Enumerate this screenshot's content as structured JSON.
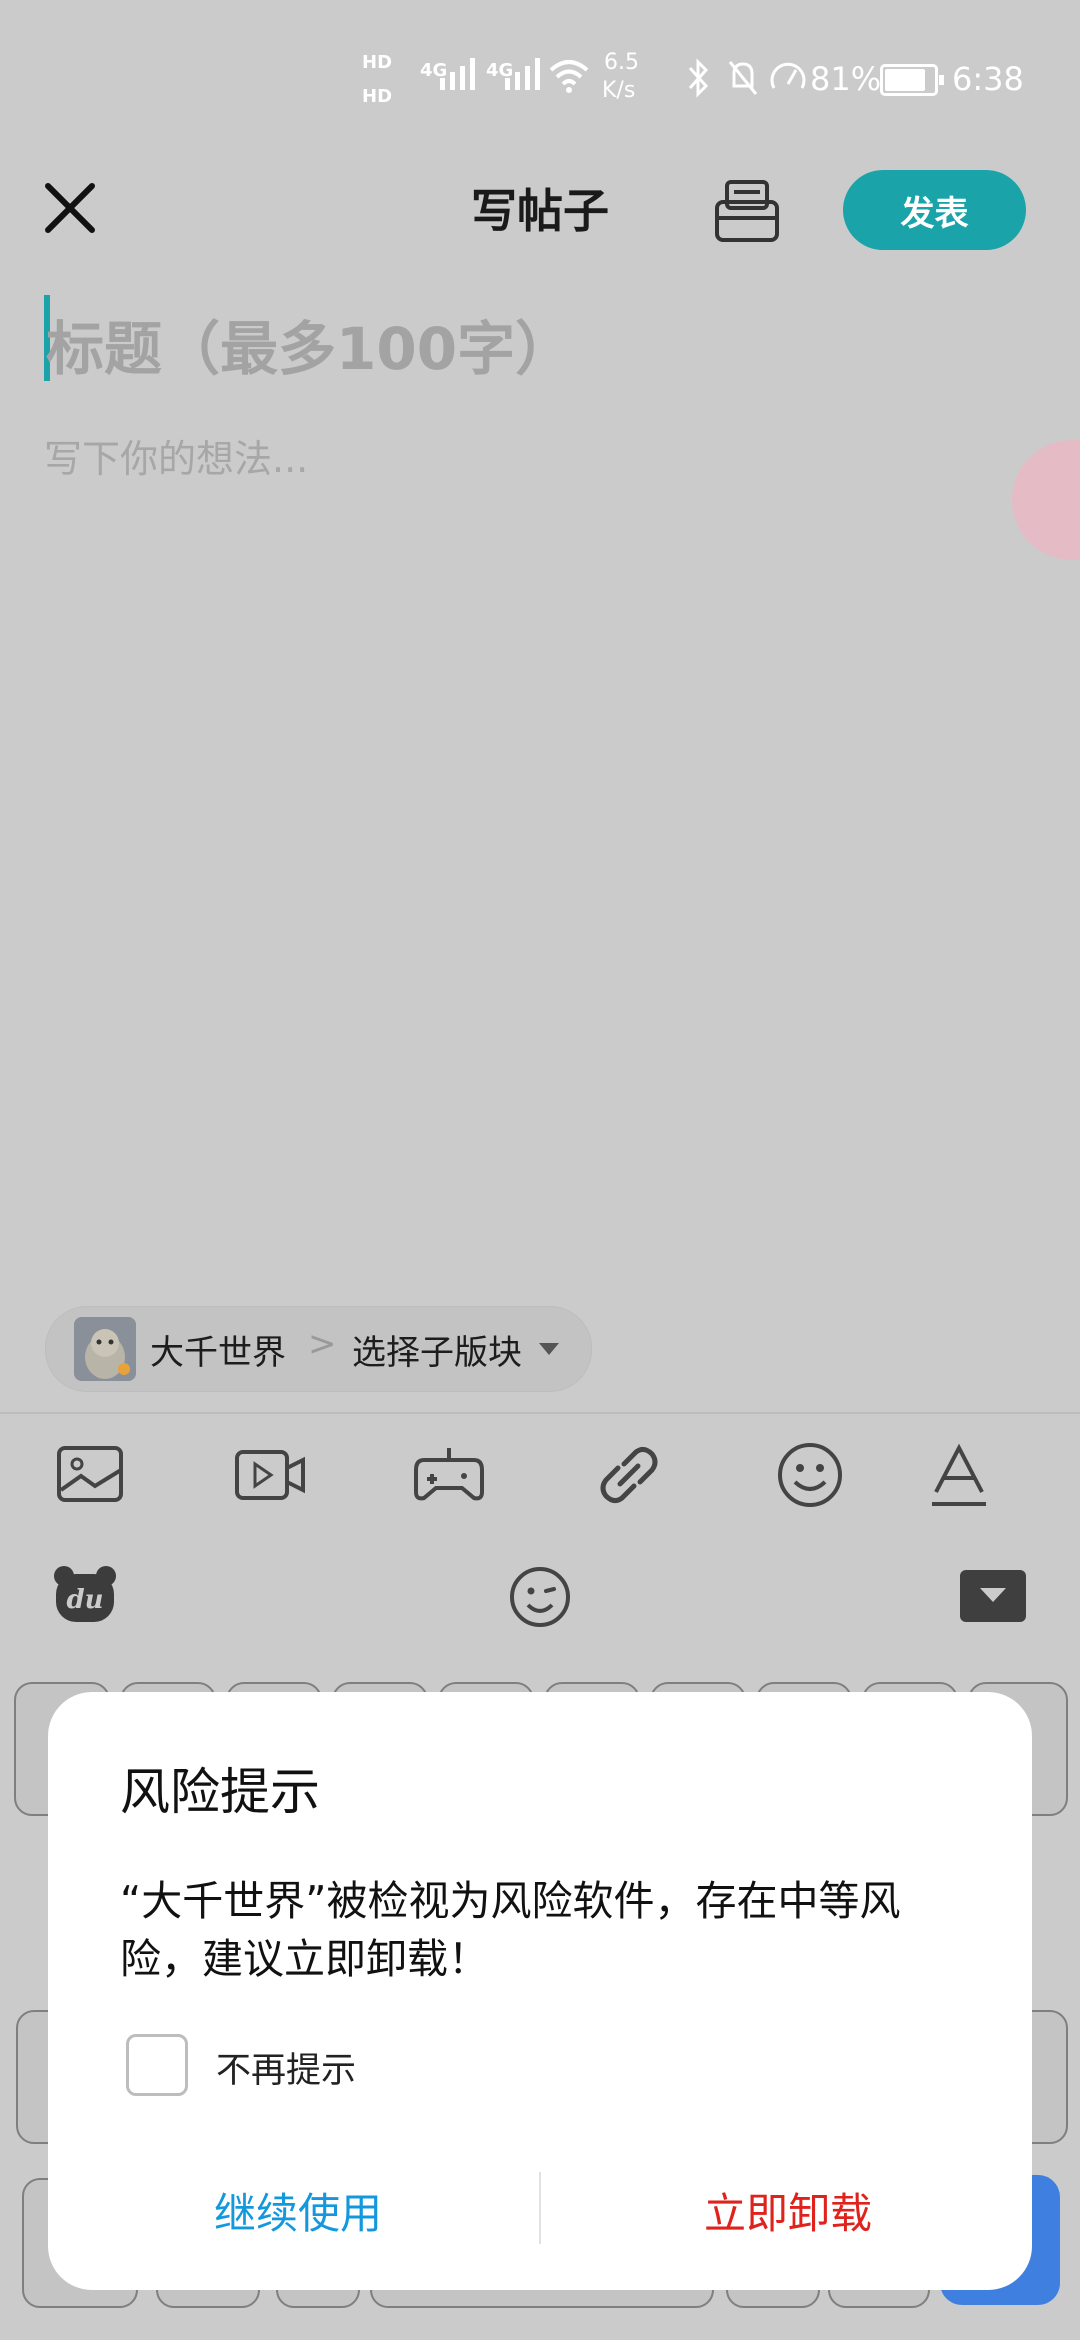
{
  "status_bar": {
    "hd1": "HD",
    "hd2": "HD",
    "net1": "4G",
    "net2": "4G",
    "speed_value": "6.5",
    "speed_unit": "K/s",
    "battery": "81%",
    "time": "6:38",
    "icons": [
      "bluetooth-icon",
      "mute-icon",
      "speedometer-icon",
      "battery-icon",
      "wifi-icon",
      "signal-icon"
    ]
  },
  "header": {
    "title": "写帖子",
    "publish_label": "发表"
  },
  "editor": {
    "title_placeholder": "标题（最多100字）",
    "body_placeholder": "写下你的想法..."
  },
  "forum_chip": {
    "forum_name": "大千世界",
    "separator": ">",
    "subforum_placeholder": "选择子版块"
  },
  "toolbar": {
    "tools": [
      "image-icon",
      "video-icon",
      "game-icon",
      "link-icon",
      "emoji-icon",
      "text-format-icon"
    ]
  },
  "keyboard": {
    "du_label": "du"
  },
  "dialog": {
    "title": "风险提示",
    "message": "“大千世界”被检视为风险软件，存在中等风险，建议立即卸载！",
    "checkbox_label": "不再提示",
    "checkbox_checked": false,
    "continue_label": "继续使用",
    "uninstall_label": "立即卸载",
    "continue_color": "#1498dd",
    "uninstall_color": "#e0221c"
  },
  "colors": {
    "accent": "#1aa3a8",
    "overlay_bg": "#cbcbcb"
  }
}
